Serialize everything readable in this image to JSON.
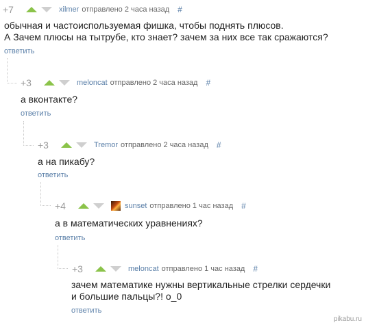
{
  "comments": [
    {
      "score": "+7",
      "user": "xilmer",
      "meta": "отправлено 2 часа назад",
      "hash": "#",
      "text": "обычная и частоиспользуемая фишка, чтобы поднять плюсов.\nА Зачем плюсы на тытрубе, кто знает? зачем за них все так сражаются?",
      "reply": "ответить"
    },
    {
      "score": "+3",
      "user": "meloncat",
      "meta": "отправлено 2 часа назад",
      "hash": "#",
      "text": "а вконтакте?",
      "reply": "ответить"
    },
    {
      "score": "+3",
      "user": "Tremor",
      "meta": "отправлено 2 часа назад",
      "hash": "#",
      "text": "а на пикабу?",
      "reply": "ответить"
    },
    {
      "score": "+4",
      "user": "sunset",
      "meta": "отправлено 1 час назад",
      "hash": "#",
      "text": "а в математических уравнениях?",
      "reply": "ответить"
    },
    {
      "score": "+3",
      "user": "meloncat",
      "meta": "отправлено 1 час назад",
      "hash": "#",
      "text": "зачем математике нужны вертикальные стрелки сердечки\nи большие пальцы?! о_0",
      "reply": "ответить"
    }
  ],
  "watermark": "pikabu.ru",
  "colors": {
    "upvote": "#8bc34a",
    "downvote": "#cfcfcf",
    "link": "#5a7fa8"
  }
}
